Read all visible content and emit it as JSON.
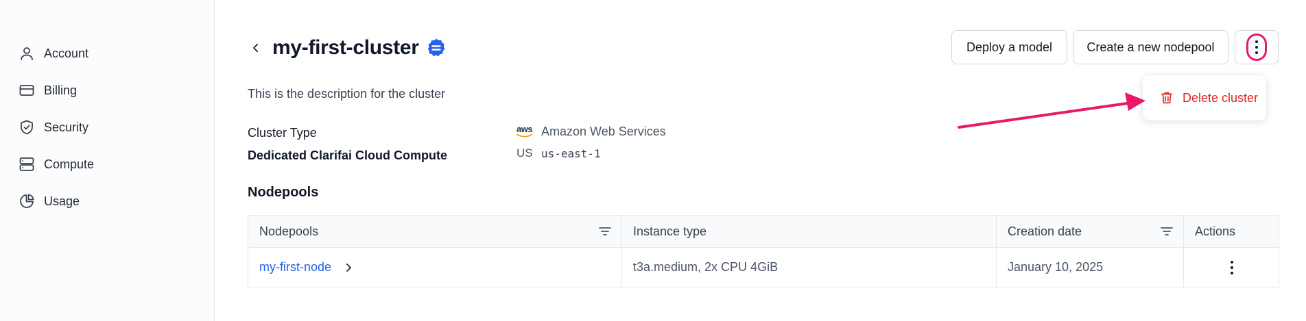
{
  "sidebar": {
    "items": [
      {
        "label": "Account",
        "icon": "user-icon"
      },
      {
        "label": "Billing",
        "icon": "credit-card-icon"
      },
      {
        "label": "Security",
        "icon": "shield-check-icon"
      },
      {
        "label": "Compute",
        "icon": "server-icon"
      },
      {
        "label": "Usage",
        "icon": "pie-chart-icon"
      }
    ]
  },
  "header": {
    "title": "my-first-cluster",
    "deploy_label": "Deploy a model",
    "create_label": "Create a new nodepool"
  },
  "menu": {
    "delete_label": "Delete cluster"
  },
  "details": {
    "description": "This is the description for the cluster",
    "cluster_type_label": "Cluster Type",
    "cluster_type_logo": "aws",
    "cluster_type_value": "Amazon Web Services",
    "compute_label": "Dedicated Clarifai Cloud Compute",
    "region_flag": "US",
    "region_value": "us-east-1"
  },
  "nodepools": {
    "section_title": "Nodepools",
    "columns": [
      "Nodepools",
      "Instance type",
      "Creation date",
      "Actions"
    ],
    "rows": [
      {
        "name": "my-first-node",
        "instance_type": "t3a.medium, 2x CPU 4GiB",
        "created": "January 10, 2025"
      }
    ]
  },
  "colors": {
    "accent_link": "#2563eb",
    "danger": "#dc2626",
    "highlight": "#e8196a",
    "verified_badge": "#2563eb"
  }
}
